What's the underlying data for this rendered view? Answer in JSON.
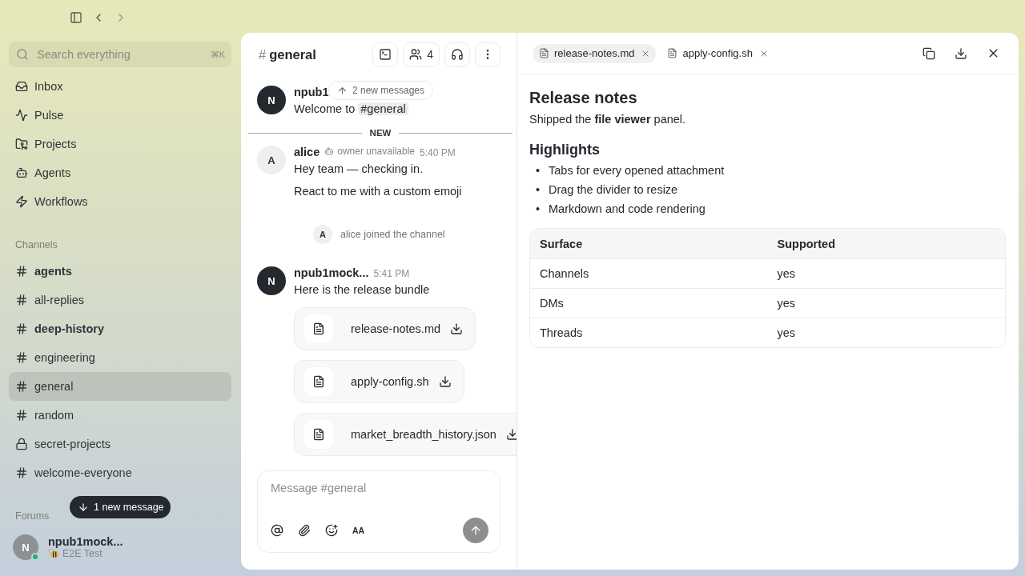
{
  "sidebar": {
    "search": {
      "placeholder": "Search everything",
      "shortcut": "⌘K"
    },
    "nav": [
      {
        "label": "Inbox"
      },
      {
        "label": "Pulse"
      },
      {
        "label": "Projects"
      },
      {
        "label": "Agents"
      },
      {
        "label": "Workflows"
      }
    ],
    "channels_heading": "Channels",
    "channels": [
      {
        "name": "agents",
        "kind": "public",
        "unread": true,
        "selected": false
      },
      {
        "name": "all-replies",
        "kind": "public",
        "unread": false,
        "selected": false
      },
      {
        "name": "deep-history",
        "kind": "public",
        "unread": true,
        "selected": false
      },
      {
        "name": "engineering",
        "kind": "public",
        "unread": false,
        "selected": false
      },
      {
        "name": "general",
        "kind": "public",
        "unread": false,
        "selected": true
      },
      {
        "name": "random",
        "kind": "public",
        "unread": false,
        "selected": false
      },
      {
        "name": "secret-projects",
        "kind": "private",
        "unread": false,
        "selected": false
      },
      {
        "name": "welcome-everyone",
        "kind": "public",
        "unread": false,
        "selected": false
      }
    ],
    "new_below": "1 new message",
    "forums_heading": "Forums",
    "user": {
      "avatar": "N",
      "name": "npub1mock...",
      "status": "E2E Test",
      "online": true
    }
  },
  "chat": {
    "channel": "general",
    "hash": "#",
    "members": "4",
    "new_above": "2 new messages",
    "messages": [
      {
        "kind": "message",
        "avatar": "N",
        "color": "#24292f",
        "author": "npub1",
        "lines": [
          "Welcome to"
        ],
        "mention": "#general"
      },
      {
        "kind": "divider",
        "label": "NEW"
      },
      {
        "kind": "message",
        "avatar": "A",
        "color": "#efefef",
        "author": "alice",
        "badge": "owner unavailable",
        "time": "5:40 PM",
        "lines": [
          "Hey team — checking in.",
          "React to me with a custom emoji"
        ]
      },
      {
        "kind": "system",
        "avatar": "A",
        "text": "alice joined the channel"
      },
      {
        "kind": "message",
        "avatar": "N",
        "color": "#24292f",
        "author": "npub1mock...",
        "time": "5:41 PM",
        "lines": [
          "Here is the release bundle"
        ],
        "attachments": [
          "release-notes.md",
          "apply-config.sh",
          "market_breadth_history.json"
        ]
      }
    ],
    "composer": {
      "placeholder": "Message #general",
      "format": "AA"
    }
  },
  "viewer": {
    "tabs": [
      {
        "label": "release-notes.md",
        "selected": true
      },
      {
        "label": "apply-config.sh",
        "selected": false
      }
    ],
    "title": "Release notes",
    "intro": "Shipped the **file viewer** panel.",
    "heading": "Highlights",
    "bullet": "•",
    "bullets": [
      "Tabs for every opened attachment",
      "Drag the divider to resize",
      "Markdown and code rendering"
    ],
    "table": {
      "columns": [
        "Surface",
        "Supported"
      ],
      "rows": [
        [
          "Channels",
          "yes"
        ],
        [
          "DMs",
          "yes"
        ],
        [
          "Threads",
          "yes"
        ]
      ]
    }
  }
}
